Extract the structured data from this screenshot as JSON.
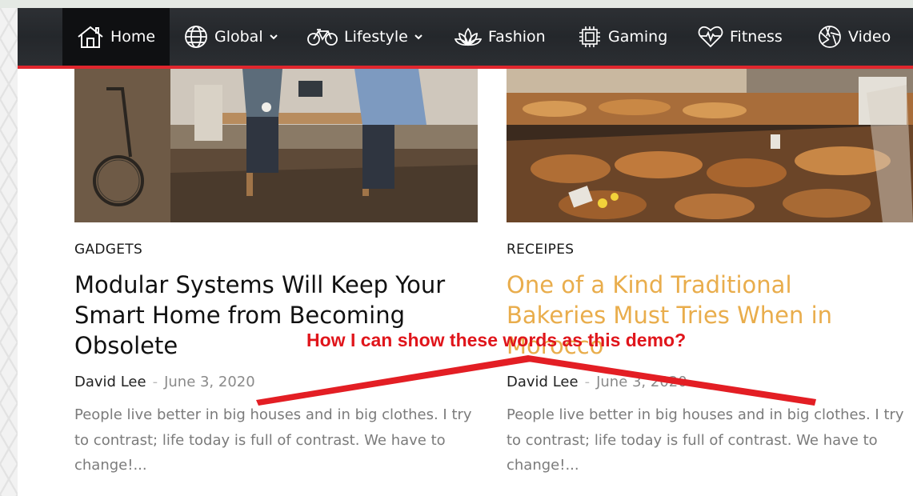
{
  "nav": {
    "items": [
      {
        "label": "Home",
        "icon": "home-icon",
        "active": true
      },
      {
        "label": "Global",
        "icon": "globe-icon",
        "dropdown": true
      },
      {
        "label": "Lifestyle",
        "icon": "bicycle-icon",
        "dropdown": true
      },
      {
        "label": "Fashion",
        "icon": "lotus-icon"
      },
      {
        "label": "Gaming",
        "icon": "chip-icon"
      },
      {
        "label": "Fitness",
        "icon": "heartbeat-icon"
      },
      {
        "label": "Video",
        "icon": "camera-aperture-icon"
      }
    ],
    "accent_color": "#e0262d"
  },
  "articles": [
    {
      "category": "GADGETS",
      "title": "Modular Systems Will Keep Your Smart Home from Becoming Obsolete",
      "author": "David Lee",
      "separator": "-",
      "date": "June 3, 2020",
      "excerpt": "People live better in big houses and in big clothes. I try to contrast; life today is full of contrast. We have to change!...",
      "title_color": "#111111"
    },
    {
      "category": "RECEIPES",
      "title": "One of a Kind Traditional Bakeries Must Tries When in Morocco",
      "author": "David Lee",
      "separator": "-",
      "date": "June 3, 2020",
      "excerpt": "People live better in big houses and in big clothes. I try to contrast; life today is full of contrast. We have to change!...",
      "title_color": "#e9ad4c"
    }
  ],
  "annotation": {
    "text": "How I can show these words as this demo?",
    "color": "#e0151b"
  }
}
